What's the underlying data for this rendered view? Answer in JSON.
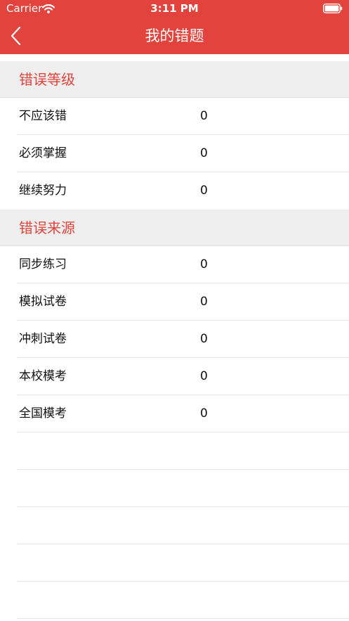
{
  "status_bar": {
    "carrier": "Carrier",
    "time": "3:11 PM"
  },
  "nav": {
    "title": "我的错题"
  },
  "colors": {
    "accent": "#e2433d",
    "section_bg": "#efefef",
    "section_text": "#e0443c"
  },
  "icons": {
    "back": "chevron-left-icon",
    "wifi": "wifi-icon",
    "battery": "battery-icon"
  },
  "sections": [
    {
      "title": "错误等级",
      "rows": [
        {
          "label": "不应该错",
          "value": "0"
        },
        {
          "label": "必须掌握",
          "value": "0"
        },
        {
          "label": "继续努力",
          "value": "0"
        }
      ]
    },
    {
      "title": "错误来源",
      "rows": [
        {
          "label": "同步练习",
          "value": "0"
        },
        {
          "label": "模拟试卷",
          "value": "0"
        },
        {
          "label": "冲刺试卷",
          "value": "0"
        },
        {
          "label": "本校模考",
          "value": "0"
        },
        {
          "label": "全国模考",
          "value": "0"
        }
      ]
    }
  ]
}
